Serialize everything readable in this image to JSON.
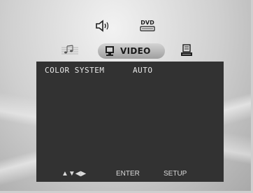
{
  "menu": {
    "icons": [
      {
        "name": "speaker-icon",
        "label": ""
      },
      {
        "name": "dvd-icon",
        "label": "DVD"
      },
      {
        "name": "music-icon",
        "label": ""
      },
      {
        "name": "monitor-icon",
        "label": ""
      },
      {
        "name": "settings-icon",
        "label": ""
      }
    ],
    "active_tab_label": "VIDEO"
  },
  "panel": {
    "setting_name": "COLOR SYSTEM",
    "setting_value": "AUTO"
  },
  "footer": {
    "nav_arrows": "▲▼◀▶",
    "enter_label": "ENTER",
    "setup_label": "SETUP"
  },
  "colors": {
    "panel_bg": "#323232",
    "panel_text": "#e8e8e8",
    "pill_bg": "#b8b8b8"
  }
}
